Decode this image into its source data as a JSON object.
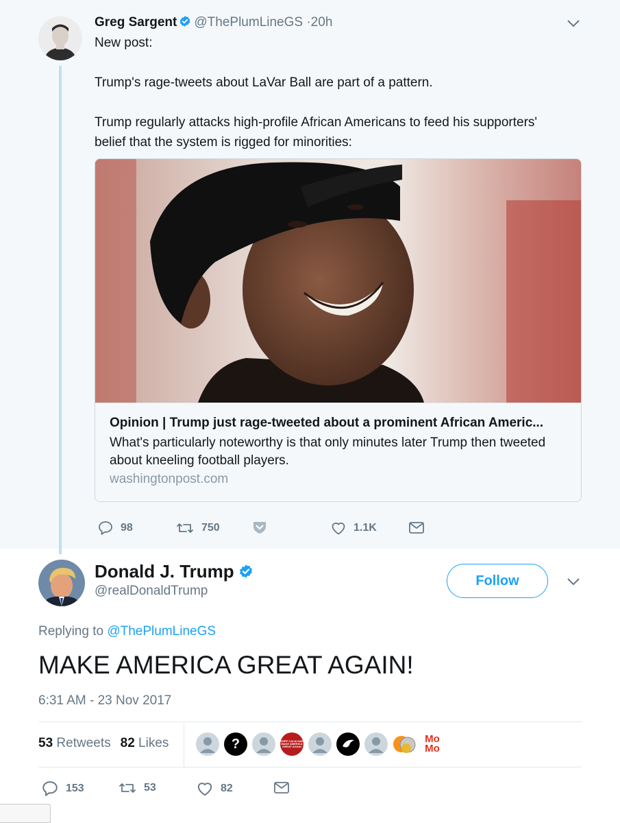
{
  "parent_tweet": {
    "author_name": "Greg Sargent",
    "handle": "@ThePlumLineGS",
    "time": "·20h",
    "text_lines": [
      "New post:",
      "",
      "Trump's rage-tweets about LaVar Ball are part of a pattern.",
      "",
      "Trump regularly attacks high-profile African Americans to feed his supporters'",
      "belief that the system is rigged for minorities:"
    ],
    "card": {
      "title": "Opinion | Trump just rage-tweeted about a prominent African Americ...",
      "description": "What's particularly noteworthy is that only minutes later Trump then tweeted about kneeling football players.",
      "domain": "washingtonpost.com"
    },
    "actions": {
      "replies": "98",
      "retweets": "750",
      "likes": "1.1K"
    }
  },
  "main_tweet": {
    "author_name": "Donald J. Trump",
    "handle": "@realDonaldTrump",
    "follow_label": "Follow",
    "replying_prefix": "Replying to",
    "replying_handle": "@ThePlumLineGS",
    "text": "MAKE AMERICA GREAT AGAIN!",
    "timestamp": "6:31 AM - 23 Nov 2017",
    "stats": {
      "retweets_count": "53",
      "retweets_label": "Retweets",
      "likes_count": "82",
      "likes_label": "Likes"
    },
    "liker_avatars": {
      "question": "?",
      "keep_calm": "KEEP CALM AND MAKE AMERICA GREAT AGAIN",
      "momo_line1": "Mo",
      "momo_line2": "Mo"
    },
    "actions": {
      "replies": "153",
      "retweets": "53",
      "likes": "82"
    }
  },
  "colors": {
    "accent": "#1da1f2",
    "muted_text": "#657786",
    "parent_background": "#f5f8fa",
    "thread_line": "#bde0f5"
  },
  "icons": [
    "reply-icon",
    "retweet-icon",
    "like-icon",
    "direct-message-icon",
    "verified-badge-icon",
    "chevron-down-icon",
    "save-shield-icon"
  ]
}
